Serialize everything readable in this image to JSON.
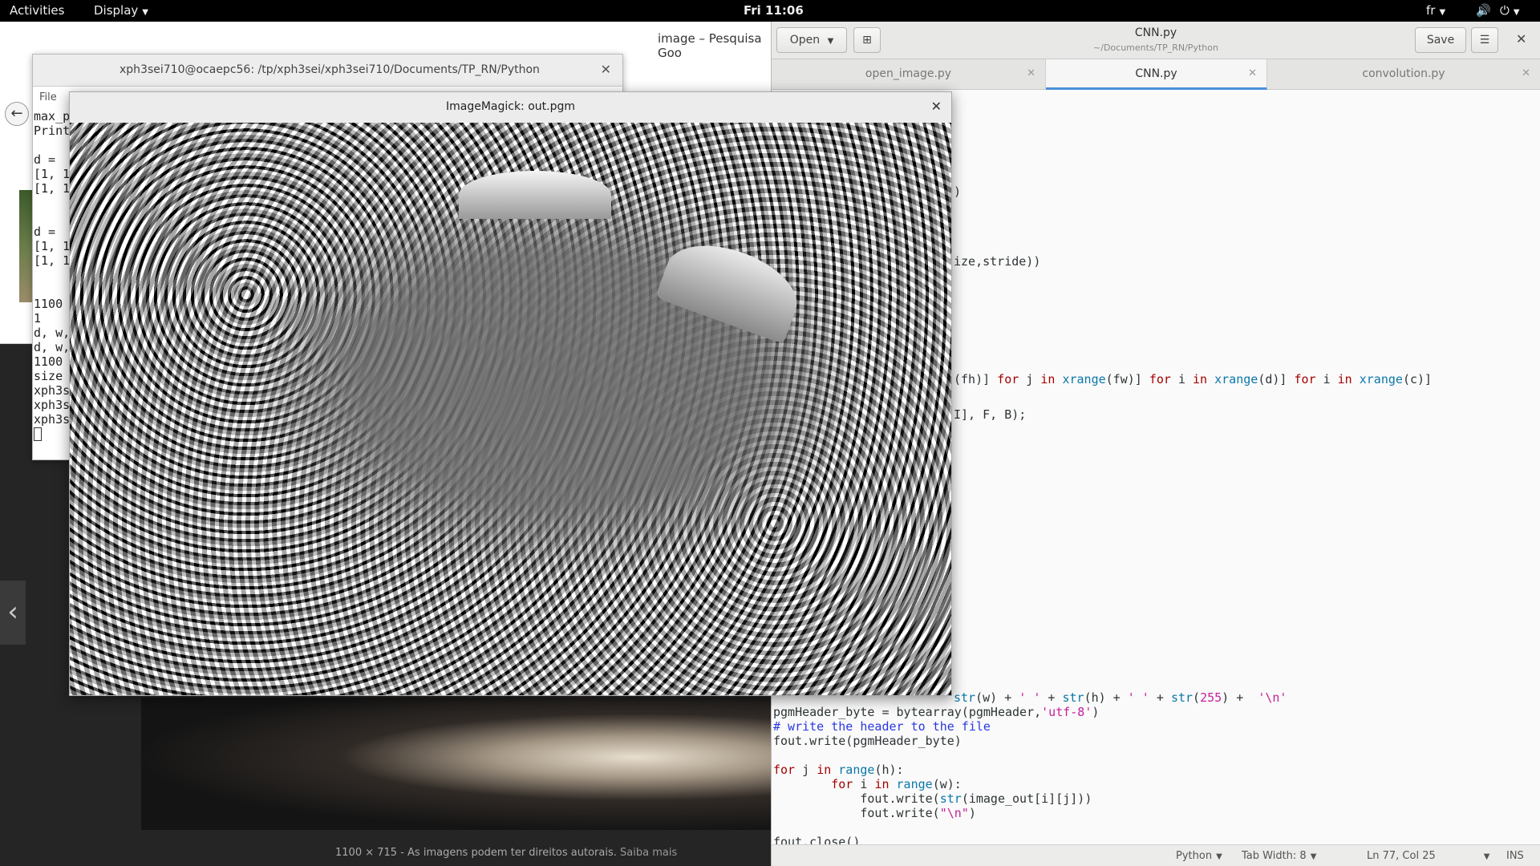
{
  "topbar": {
    "activities": "Activities",
    "display_menu": "Display",
    "clock": "Fri 11:06",
    "language": "fr"
  },
  "browser": {
    "title": "image – Pesquisa Goo",
    "caption_size": "1100 × 715",
    "caption_sep": " - ",
    "caption_text": "As imagens podem ter direitos autorais.",
    "caption_link": "Saiba mais"
  },
  "terminal": {
    "title": "xph3sei710@ocaepc56: /tp/xph3sei/xph3sei710/Documents/TP_RN/Python",
    "menu_file": "File",
    "lines": [
      "max_p",
      "Print",
      "",
      "d =",
      "[1, 1",
      "[1, 1",
      "",
      "",
      "d =",
      "[1, 1",
      "[1, 1",
      "",
      "",
      "1100",
      "1",
      "d, w,",
      "d, w,",
      "1100",
      "size",
      "xph3s",
      "xph3s",
      "xph3s"
    ]
  },
  "imagemagick": {
    "title": "ImageMagick: out.pgm"
  },
  "gedit": {
    "open_label": "Open",
    "save_label": "Save",
    "title": "CNN.py",
    "subtitle": "~/Documents/TP_RN/Python",
    "tabs": [
      {
        "label": "open_image.py"
      },
      {
        "label": "CNN.py"
      },
      {
        "label": "convolution.py"
      }
    ],
    "code": {
      "l1": ")",
      "l2a": "ize,stride))",
      "l3a": "(fh)] ",
      "l3b": "for",
      "l3c": " j ",
      "l3d": "in",
      "l3e": " ",
      "l3f": "xrange",
      "l3g": "(fw)] ",
      "l3h": "for",
      "l3i": " i ",
      "l3j": "in",
      "l3k": " ",
      "l3l": "xrange",
      "l3m": "(d)] ",
      "l3n": "for",
      "l3o": " i ",
      "l3p": "in",
      "l3q": " ",
      "l3r": "xrange",
      "l3s": "(c)]",
      "l4": "I], F, B);",
      "l5a": "str",
      "l5b": "(w) + ",
      "l5c": "' '",
      "l5d": " + ",
      "l5e": "str",
      "l5f": "(h) + ",
      "l5g": "' '",
      "l5h": " + ",
      "l5i": "str",
      "l5j": "(",
      "l5k": "255",
      "l5l": ") +  ",
      "l5m": "'\\n'",
      "l6a": "pgmHeader_byte = bytearray(pgmHeader,",
      "l6b": "'utf-8'",
      "l6c": ")",
      "l7": "# write the header to the file",
      "l8": "fout.write(pgmHeader_byte)",
      "l9a": "for",
      "l9b": " j ",
      "l9c": "in",
      "l9d": " ",
      "l9e": "range",
      "l9f": "(h):",
      "l10a": "        ",
      "l10b": "for",
      "l10c": " i ",
      "l10d": "in",
      "l10e": " ",
      "l10f": "range",
      "l10g": "(w):",
      "l11a": "            fout.write(",
      "l11b": "str",
      "l11c": "(image_out[i][j]))",
      "l12a": "            fout.write(",
      "l12b": "\"\\n\"",
      "l12c": ")",
      "l13": "fout.close()"
    },
    "status": {
      "language": "Python",
      "tab_width": "Tab Width: 8",
      "position": "Ln 77, Col 25",
      "mode": "INS"
    }
  },
  "colors": {
    "accent": "#4a90d9",
    "keyword": "#a40000",
    "builtin": "#0a77a8",
    "string": "#c4219a",
    "comment": "#2a38e0"
  }
}
